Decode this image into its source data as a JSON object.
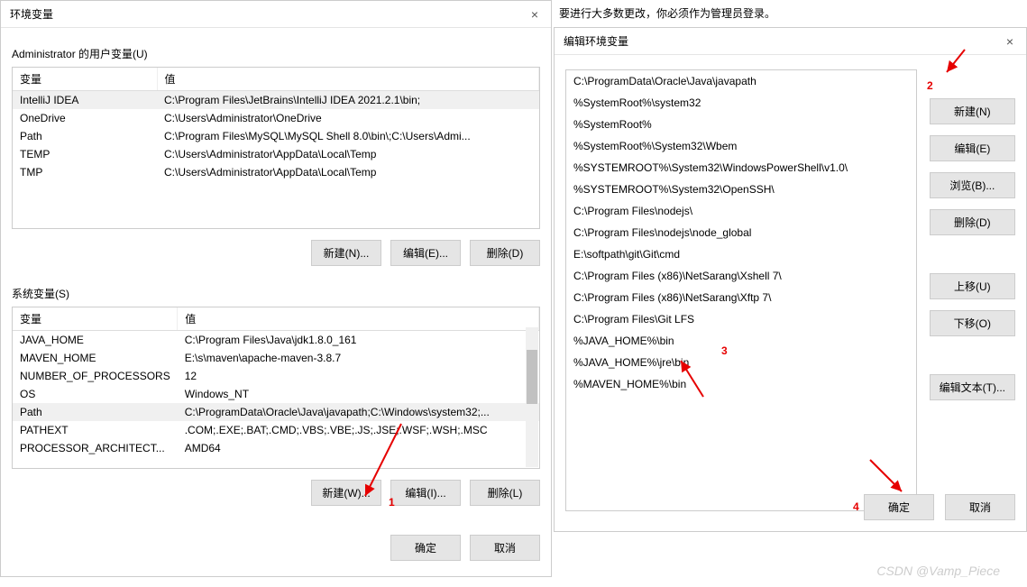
{
  "top_hint": "要进行大多数更改，你必须作为管理员登录。",
  "env_dialog": {
    "title": "环境变量",
    "user_section_label": "Administrator 的用户变量(U)",
    "headers": {
      "var": "变量",
      "val": "值"
    },
    "user_vars": [
      {
        "name": "IntelliJ IDEA",
        "value": "C:\\Program Files\\JetBrains\\IntelliJ IDEA 2021.2.1\\bin;",
        "selected": true
      },
      {
        "name": "OneDrive",
        "value": "C:\\Users\\Administrator\\OneDrive"
      },
      {
        "name": "Path",
        "value": "C:\\Program Files\\MySQL\\MySQL Shell 8.0\\bin\\;C:\\Users\\Admi..."
      },
      {
        "name": "TEMP",
        "value": "C:\\Users\\Administrator\\AppData\\Local\\Temp"
      },
      {
        "name": "TMP",
        "value": "C:\\Users\\Administrator\\AppData\\Local\\Temp"
      }
    ],
    "user_buttons": {
      "new": "新建(N)...",
      "edit": "编辑(E)...",
      "delete": "删除(D)"
    },
    "sys_section_label": "系统变量(S)",
    "sys_vars": [
      {
        "name": "JAVA_HOME",
        "value": "C:\\Program Files\\Java\\jdk1.8.0_161"
      },
      {
        "name": "MAVEN_HOME",
        "value": "E:\\s\\maven\\apache-maven-3.8.7"
      },
      {
        "name": "NUMBER_OF_PROCESSORS",
        "value": "12"
      },
      {
        "name": "OS",
        "value": "Windows_NT"
      },
      {
        "name": "Path",
        "value": "C:\\ProgramData\\Oracle\\Java\\javapath;C:\\Windows\\system32;...",
        "selected": true
      },
      {
        "name": "PATHEXT",
        "value": ".COM;.EXE;.BAT;.CMD;.VBS;.VBE;.JS;.JSE;.WSF;.WSH;.MSC"
      },
      {
        "name": "PROCESSOR_ARCHITECT...",
        "value": "AMD64"
      }
    ],
    "sys_buttons": {
      "new": "新建(W)...",
      "edit": "编辑(I)...",
      "delete": "删除(L)"
    },
    "bottom_buttons": {
      "ok": "确定",
      "cancel": "取消"
    }
  },
  "edit_dialog": {
    "title": "编辑环境变量",
    "items": [
      "C:\\ProgramData\\Oracle\\Java\\javapath",
      "%SystemRoot%\\system32",
      "%SystemRoot%",
      "%SystemRoot%\\System32\\Wbem",
      "%SYSTEMROOT%\\System32\\WindowsPowerShell\\v1.0\\",
      "%SYSTEMROOT%\\System32\\OpenSSH\\",
      "C:\\Program Files\\nodejs\\",
      "C:\\Program Files\\nodejs\\node_global",
      "E:\\softpath\\git\\Git\\cmd",
      "C:\\Program Files (x86)\\NetSarang\\Xshell 7\\",
      "C:\\Program Files (x86)\\NetSarang\\Xftp 7\\",
      "C:\\Program Files\\Git LFS",
      "%JAVA_HOME%\\bin",
      "%JAVA_HOME%\\jre\\bin",
      "%MAVEN_HOME%\\bin"
    ],
    "buttons": {
      "new": "新建(N)",
      "edit": "编辑(E)",
      "browse": "浏览(B)...",
      "delete": "删除(D)",
      "move_up": "上移(U)",
      "move_down": "下移(O)",
      "edit_text": "编辑文本(T)...",
      "ok": "确定",
      "cancel": "取消"
    }
  },
  "annotations": {
    "n1": "1",
    "n2": "2",
    "n3": "3",
    "n4": "4"
  },
  "watermark": "CSDN @Vamp_Piece"
}
